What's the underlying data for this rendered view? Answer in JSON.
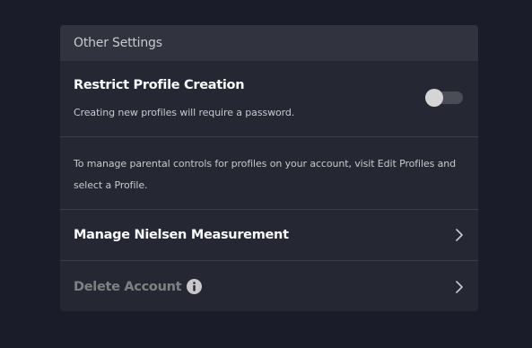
{
  "settings": {
    "header": "Other Settings",
    "restrict": {
      "title": "Restrict Profile Creation",
      "description": "Creating new profiles will require a password.",
      "enabled": false
    },
    "parental_text": "To manage parental controls for profiles on your account, visit Edit Profiles and select a Profile.",
    "nielsen_label": "Manage Nielsen Measurement",
    "delete_label": "Delete Account"
  },
  "icons": {
    "info": "info-icon",
    "chevron": "chevron-right-icon"
  },
  "colors": {
    "background": "#1a1d29",
    "panel": "#252833",
    "header": "#31343e",
    "text_primary": "#f9f9f9",
    "text_secondary": "#cacaca",
    "text_disabled": "#808080"
  }
}
